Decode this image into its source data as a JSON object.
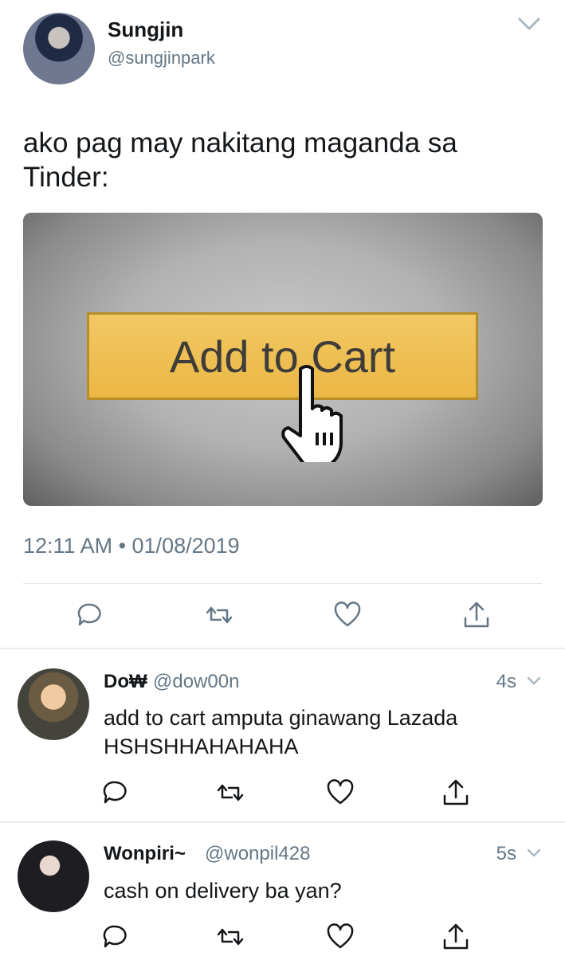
{
  "tweet": {
    "author_name": "Sungjin",
    "author_handle": "@sungjinpark",
    "text": "ako pag may nakitang maganda sa Tinder:",
    "media": {
      "button_label": "Add to Cart",
      "icon": "hand-cursor-icon"
    },
    "timestamp": "12:11 AM • 01/08/2019",
    "actions": [
      "reply-icon",
      "retweet-icon",
      "like-icon",
      "share-icon"
    ]
  },
  "replies": [
    {
      "author_name": "Do₩",
      "author_handle": "@dow00n",
      "time": "4s",
      "text": "add to cart amputa ginawang Lazada HSHSHHAHAHAHA"
    },
    {
      "author_name": "Wonpiri~",
      "author_handle": "@wonpil428",
      "time": "5s",
      "text": "cash on delivery ba yan?"
    }
  ],
  "colors": {
    "secondary_text": "#657786",
    "button_yellow": "#ebb745",
    "divider": "#e1e8ed"
  }
}
